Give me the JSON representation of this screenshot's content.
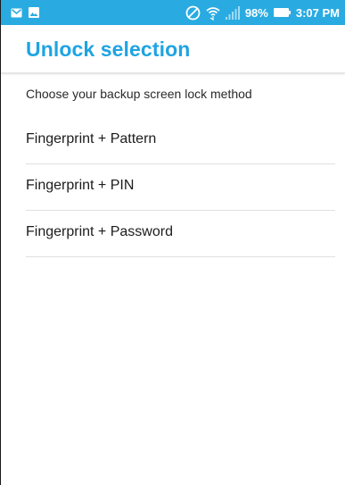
{
  "status_bar": {
    "notification_icons": [
      "gmail-icon",
      "image-icon"
    ],
    "status_icons": [
      "do-not-disturb-icon",
      "wifi-icon",
      "cell-signal-icon"
    ],
    "battery_percent": "98%",
    "time": "3:07 PM",
    "background_color": "#29abe2"
  },
  "app_bar": {
    "title": "Unlock selection",
    "title_color": "#1ea4e3"
  },
  "content": {
    "subtitle": "Choose your backup screen lock method",
    "options": [
      {
        "label": "Fingerprint + Pattern"
      },
      {
        "label": "Fingerprint + PIN"
      },
      {
        "label": "Fingerprint + Password"
      }
    ]
  }
}
